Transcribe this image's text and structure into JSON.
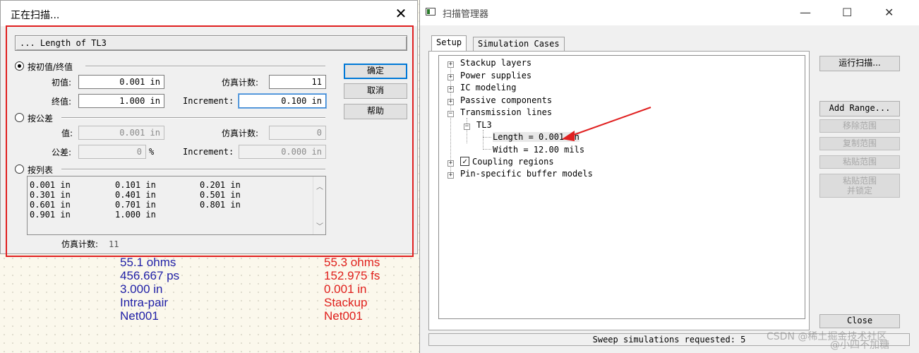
{
  "canvas": {
    "left_values": [
      "55.1 ohms",
      "456.667 ps",
      "3.000 in",
      "Intra-pair",
      "Net001"
    ],
    "right_values": [
      "55.3 ohms",
      "152.975 fs",
      "0.001 in",
      "Stackup",
      "Net001"
    ]
  },
  "scan_dialog": {
    "title": "正在扫描...",
    "path": "... Length of TL3",
    "range_group": {
      "label": "按初值/终值",
      "start_label": "初值:",
      "start_value": "0.001 in",
      "end_label": "终值:",
      "end_value": "1.000 in",
      "sim_count_label": "仿真计数:",
      "sim_count_value": "11",
      "increment_label": "Increment:",
      "increment_value": "0.100 in"
    },
    "tolerance_group": {
      "label": "按公差",
      "value_label": "值:",
      "value_value": "0.001 in",
      "tolerance_label": "公差:",
      "tolerance_value": "0",
      "tolerance_unit": "%",
      "sim_count_label": "仿真计数:",
      "sim_count_value": "0",
      "increment_label": "Increment:",
      "increment_value": "0.000 in"
    },
    "list_group": {
      "label": "按列表",
      "columns": [
        [
          "0.001 in",
          "0.301 in",
          "0.601 in",
          "0.901 in"
        ],
        [
          "0.101 in",
          "0.401 in",
          "0.701 in",
          "1.000 in"
        ],
        [
          "0.201 in",
          "0.501 in",
          "0.801 in"
        ]
      ]
    },
    "footer_label": "仿真计数:",
    "footer_value": "11",
    "buttons": {
      "ok": "确定",
      "cancel": "取消",
      "help": "帮助"
    }
  },
  "sweep_manager": {
    "title": "扫描管理器",
    "tabs": [
      "Setup",
      "Simulation Cases"
    ],
    "tree": {
      "stackup": "Stackup layers",
      "power": "Power supplies",
      "ic": "IC modeling",
      "passive": "Passive components",
      "transmission": "Transmission lines",
      "tl3": "TL3",
      "length": "Length = 0.001 in",
      "width": "Width = 12.00 mils",
      "coupling": "Coupling regions",
      "pin": "Pin-specific buffer models"
    },
    "buttons": {
      "run": "运行扫描...",
      "add_range": "Add Range...",
      "remove_range": "移除范围",
      "copy_range": "复制范围",
      "paste_range": "粘贴范围",
      "paste_lock_1": "粘贴范围",
      "paste_lock_2": "并锁定",
      "close": "Close"
    },
    "status": "Sweep simulations requested: 5"
  },
  "watermark": "CSDN @稀土掘金技术社区",
  "watermark2": "@小四不加糖"
}
